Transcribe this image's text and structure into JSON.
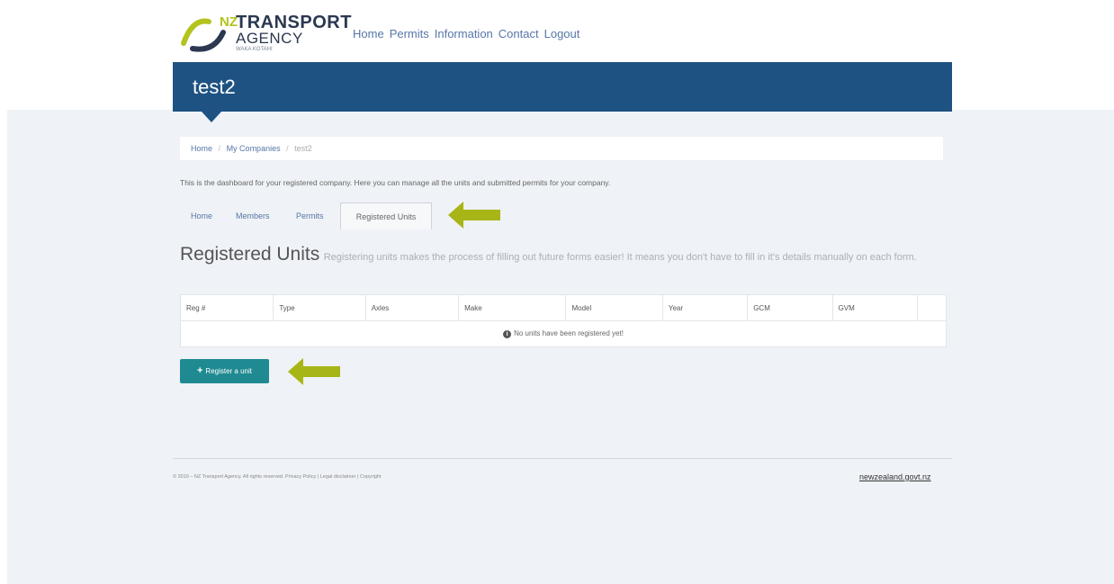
{
  "logo": {
    "nz": "NZ",
    "line1": "TRANSPORT",
    "line2": "AGENCY",
    "line3": "WAKA KOTAHI"
  },
  "top_nav": [
    "Home",
    "Permits",
    "Information",
    "Contact",
    "Logout"
  ],
  "page_title": "test2",
  "breadcrumb": {
    "home": "Home",
    "my_companies": "My Companies",
    "current": "test2"
  },
  "intro": "This is the dashboard for your registered company. Here you can manage all the units and submitted permits for your company.",
  "tabs": [
    {
      "label": "Home",
      "active": false
    },
    {
      "label": "Members",
      "active": false
    },
    {
      "label": "Permits",
      "active": false
    },
    {
      "label": "Registered Units",
      "active": true
    }
  ],
  "section": {
    "title": "Registered Units",
    "description": "Registering units makes the process of filling out future forms easier! It means you don't have to fill in it's details manually on each form."
  },
  "table": {
    "headers": [
      "Reg #",
      "Type",
      "Axles",
      "Make",
      "Model",
      "Year",
      "GCM",
      "GVM",
      ""
    ],
    "empty_message": "No units have been registered yet!"
  },
  "register_button": "Register a unit",
  "footer": {
    "left": "© 2019 – NZ Transport Agency. All rights reserved. Privacy Policy | Legal disclaimer | Copyright",
    "right": "newzealand.govt.nz"
  },
  "colors": {
    "header_blue": "#1e5282",
    "button_teal": "#1f8a91",
    "arrow_green": "#a8b517",
    "page_bg": "#eff2f6",
    "link_blue": "#5776a8"
  },
  "icons": [
    "info-circle-icon",
    "plus-icon",
    "arrow-left-icon"
  ]
}
